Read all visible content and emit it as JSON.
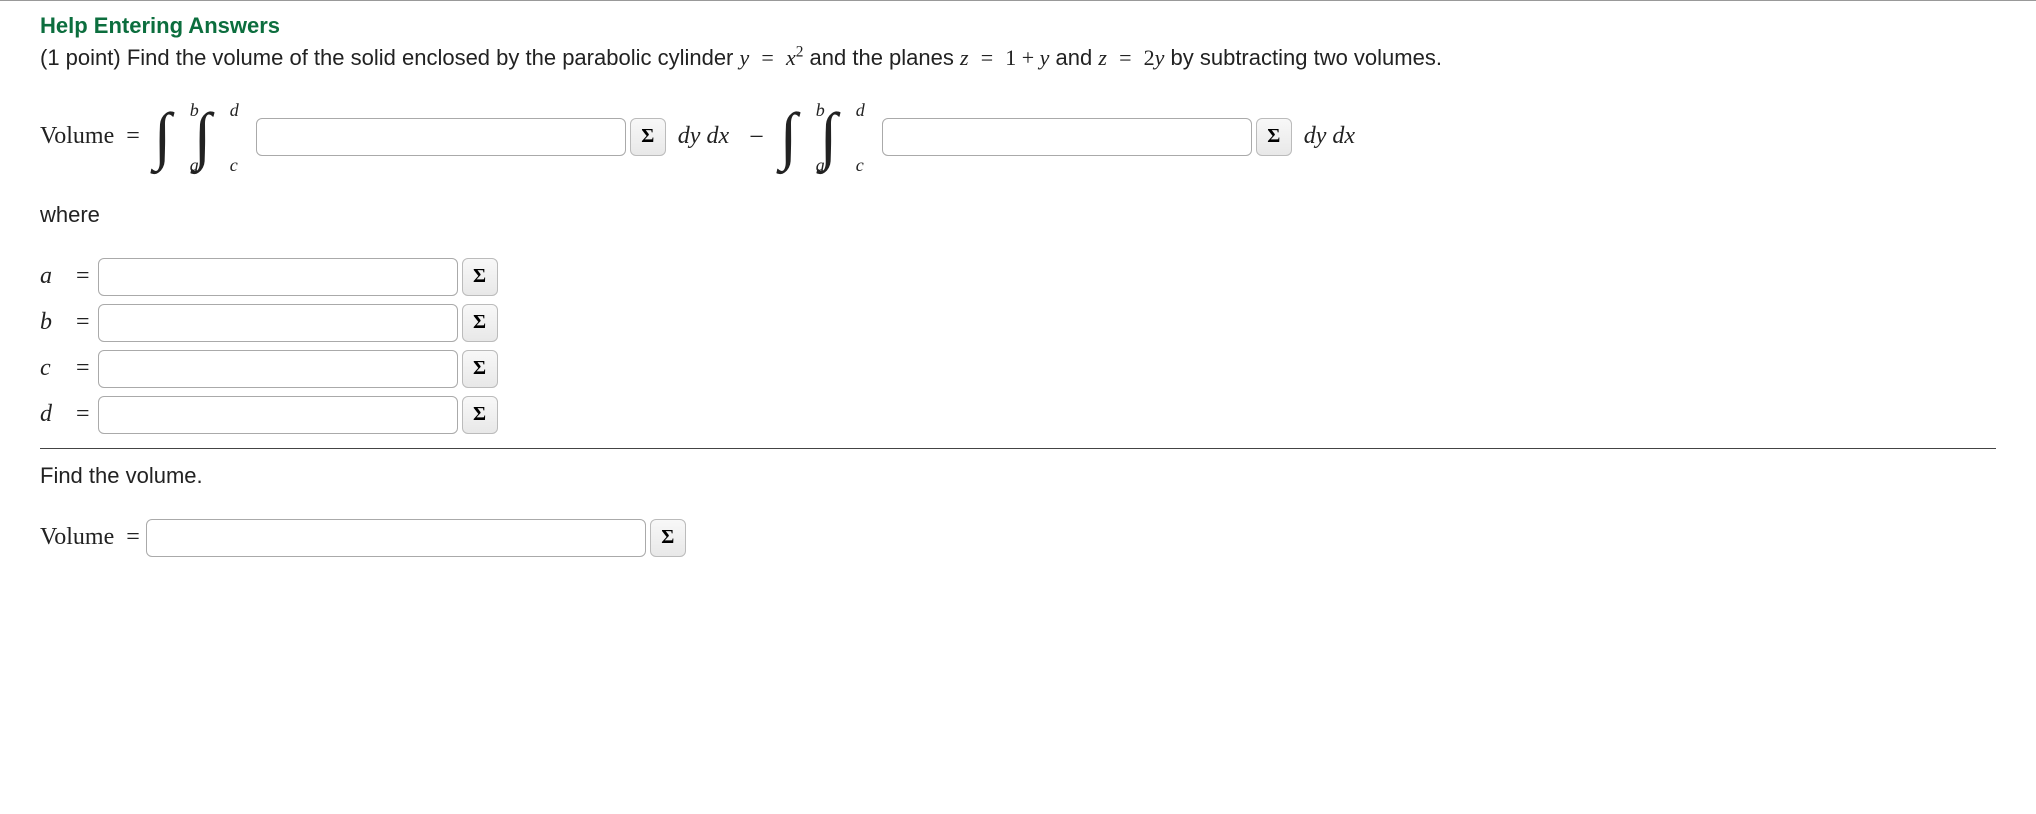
{
  "help_link": "Help Entering Answers",
  "problem": {
    "prefix": "(1 point) Find the volume of the solid enclosed by the parabolic cylinder ",
    "eq1_lhs": "y",
    "eq1_rhs_base": "x",
    "eq1_rhs_exp": "2",
    "mid1": " and the planes ",
    "eq2_lhs": "z",
    "eq2_rhs": "1 + y",
    "mid2": " and ",
    "eq3_lhs": "z",
    "eq3_rhs": "2y",
    "suffix": " by subtracting two volumes."
  },
  "volume_label": "Volume",
  "equals": "=",
  "integral": {
    "outer_lower": "a",
    "outer_upper": "b",
    "inner_lower": "c",
    "inner_upper": "d"
  },
  "dydx": "dy dx",
  "minus": "−",
  "sigma": "Σ",
  "where": "where",
  "bounds": {
    "a": "a",
    "b": "b",
    "c": "c",
    "d": "d"
  },
  "find_volume": "Find the volume."
}
